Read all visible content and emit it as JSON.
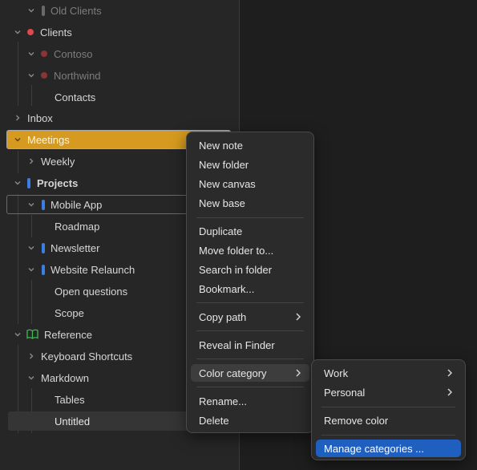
{
  "tree": {
    "old_clients": "Old Clients",
    "clients": "Clients",
    "contoso": "Contoso",
    "northwind": "Northwind",
    "contacts": "Contacts",
    "inbox": "Inbox",
    "meetings": "Meetings",
    "weekly": "Weekly",
    "projects": "Projects",
    "mobile_app": "Mobile App",
    "roadmap": "Roadmap",
    "newsletter": "Newsletter",
    "website_relaunch": "Website Relaunch",
    "open_questions": "Open questions",
    "scope": "Scope",
    "reference": "Reference",
    "keyboard_shortcuts": "Keyboard Shortcuts",
    "markdown": "Markdown",
    "tables": "Tables",
    "untitled": "Untitled"
  },
  "context_menu": {
    "new_note": "New note",
    "new_folder": "New folder",
    "new_canvas": "New canvas",
    "new_base": "New base",
    "duplicate": "Duplicate",
    "move_folder_to": "Move folder to...",
    "search_in_folder": "Search in folder",
    "bookmark": "Bookmark...",
    "copy_path": "Copy path",
    "reveal_in_finder": "Reveal in Finder",
    "color_category": "Color category",
    "rename": "Rename...",
    "delete": "Delete"
  },
  "submenu": {
    "work": "Work",
    "personal": "Personal",
    "remove_color": "Remove color",
    "manage_categories": "Manage categories ..."
  },
  "colors": {
    "highlight": "#d59a1f",
    "menu_active": "#1f5fbf",
    "red": "#e0484b",
    "blue": "#3d7fe0",
    "green": "#3fb950"
  }
}
